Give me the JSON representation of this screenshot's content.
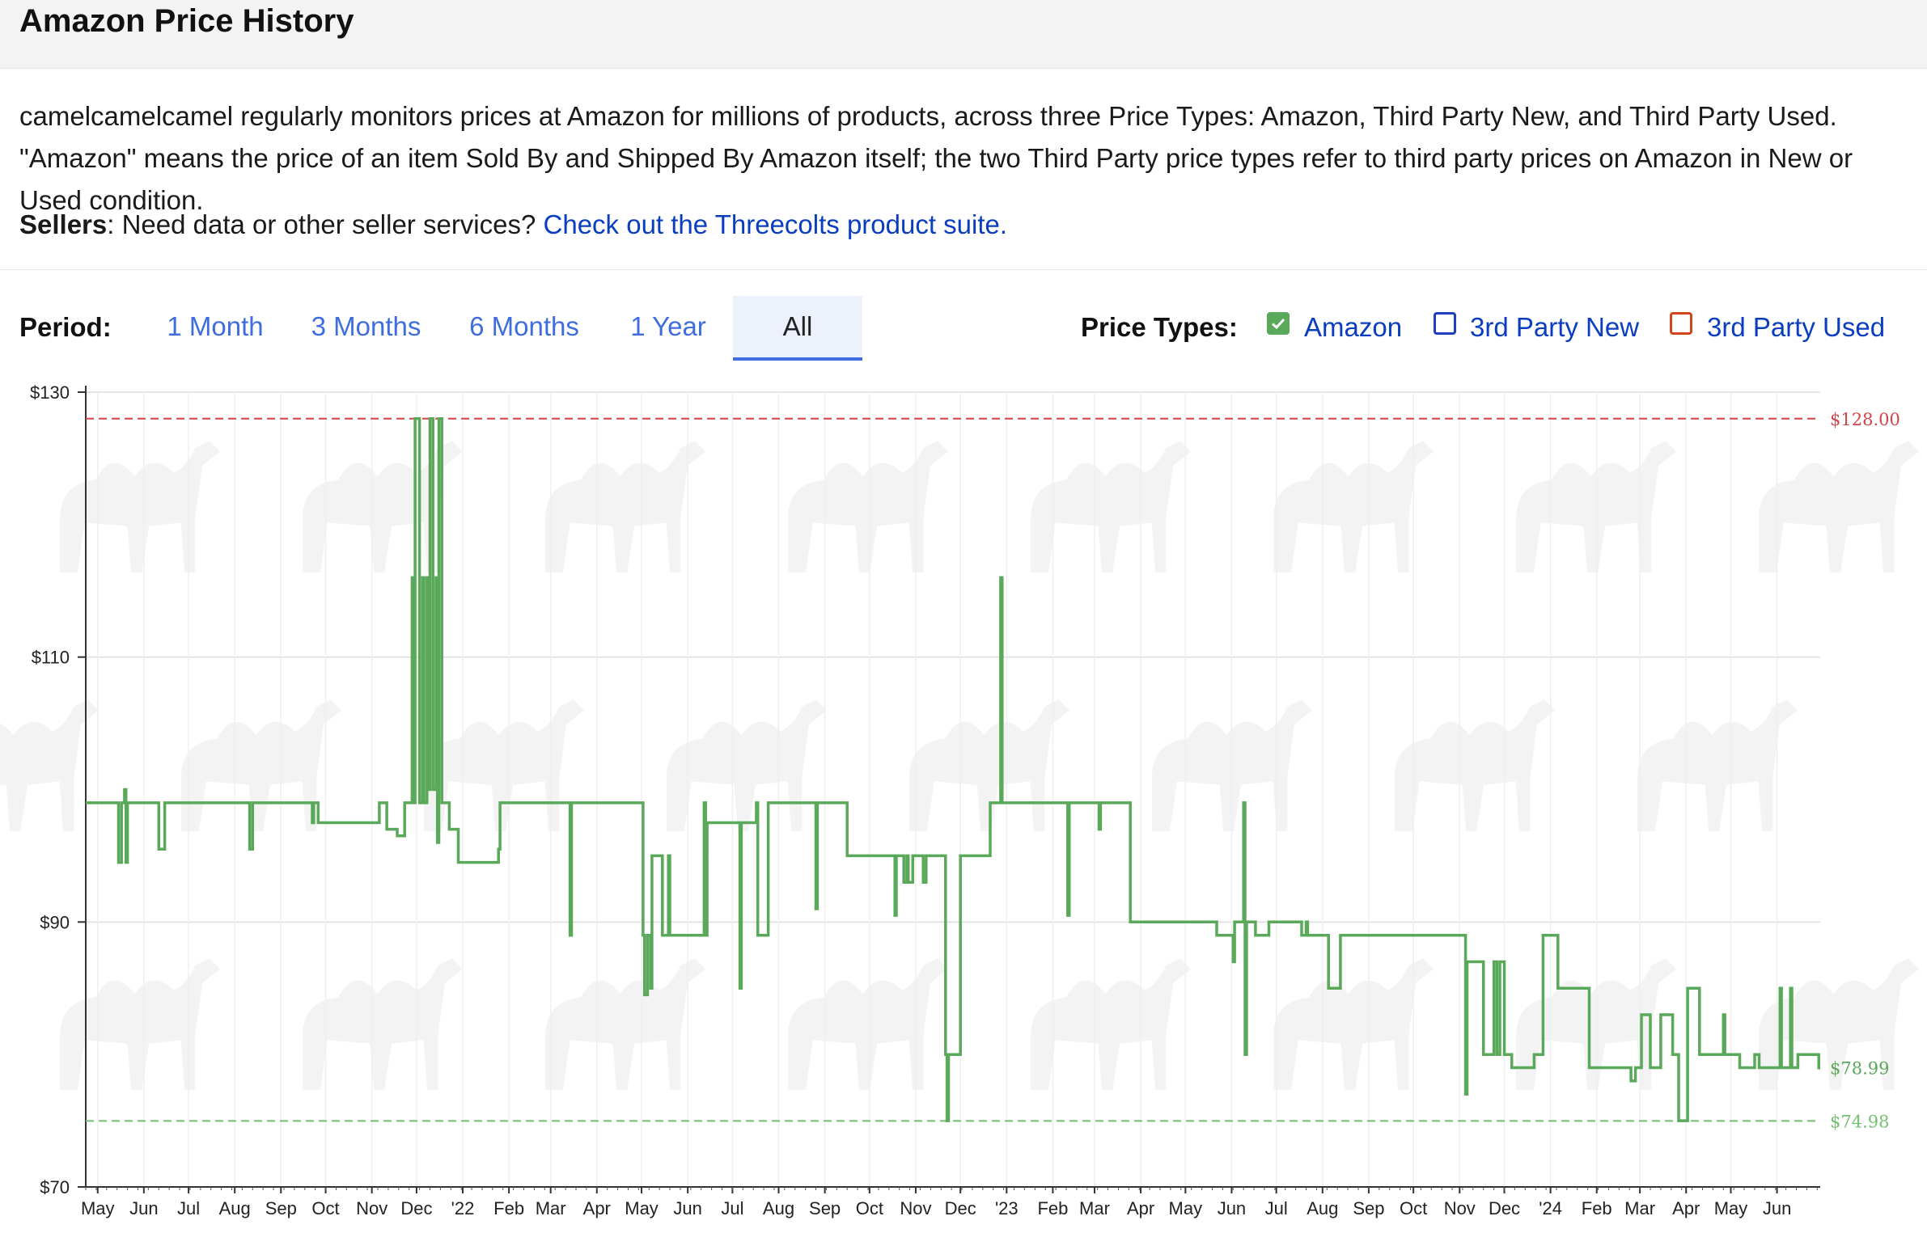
{
  "header": {
    "title": "Amazon Price History"
  },
  "description": "camelcamelcamel regularly monitors prices at Amazon for millions of products, across three Price Types: Amazon, Third Party New, and Third Party Used. \"Amazon\" means the price of an item Sold By and Shipped By Amazon itself; the two Third Party price types refer to third party prices on Amazon in New or Used condition.",
  "sellers": {
    "label": "Sellers",
    "text": ": Need data or other seller services? ",
    "link": "Check out the Threecolts product suite."
  },
  "period": {
    "label": "Period:",
    "tabs": [
      "1 Month",
      "3 Months",
      "6 Months",
      "1 Year",
      "All"
    ],
    "selected": "All"
  },
  "price_types": {
    "label": "Price Types:",
    "items": [
      {
        "label": "Amazon",
        "checked": true,
        "color": "#5aa85a"
      },
      {
        "label": "3rd Party New",
        "checked": false,
        "color": "#1f3fbf"
      },
      {
        "label": "3rd Party Used",
        "checked": false,
        "color": "#d0451b"
      }
    ]
  },
  "chart_data": {
    "type": "line",
    "x_type": "date",
    "ylim": [
      70,
      130
    ],
    "yticks": [
      "$130",
      "$110",
      "$90",
      "$70"
    ],
    "xlim": [
      "2021-04-23",
      "2024-06-30"
    ],
    "month_ticks": [
      "May",
      "Jun",
      "Jul",
      "Aug",
      "Sep",
      "Oct",
      "Nov",
      "Dec",
      "'22",
      "Feb",
      "Mar",
      "Apr",
      "May",
      "Jun",
      "Jul",
      "Aug",
      "Sep",
      "Oct",
      "Nov",
      "Dec",
      "'23",
      "Feb",
      "Mar",
      "Apr",
      "May",
      "Jun",
      "Jul",
      "Aug",
      "Sep",
      "Oct",
      "Nov",
      "Dec",
      "'24",
      "Feb",
      "Mar",
      "Apr",
      "May",
      "Jun"
    ],
    "reference_lines": [
      {
        "label": "$128.00",
        "value": 128.0,
        "color": "#d0454b",
        "style": "dashed"
      },
      {
        "label": "$74.98",
        "value": 74.98,
        "color": "#72c072",
        "style": "dashed"
      }
    ],
    "current_price_label": {
      "label": "$78.99",
      "value": 78.99,
      "color": "#5aa85a"
    },
    "series": [
      {
        "name": "Amazon",
        "color": "#5aa85a",
        "points": [
          [
            "2021-04-23",
            99
          ],
          [
            "2021-05-14",
            99
          ],
          [
            "2021-05-15",
            94.5
          ],
          [
            "2021-05-17",
            99
          ],
          [
            "2021-05-19",
            100
          ],
          [
            "2021-05-20",
            94.5
          ],
          [
            "2021-05-21",
            99
          ],
          [
            "2021-06-10",
            99
          ],
          [
            "2021-06-11",
            95.5
          ],
          [
            "2021-06-15",
            99
          ],
          [
            "2021-07-15",
            99
          ],
          [
            "2021-08-10",
            99
          ],
          [
            "2021-08-11",
            95.5
          ],
          [
            "2021-08-13",
            99
          ],
          [
            "2021-09-21",
            99
          ],
          [
            "2021-09-22",
            97.5
          ],
          [
            "2021-09-23",
            99
          ],
          [
            "2021-09-26",
            97.5
          ],
          [
            "2021-10-05",
            97.5
          ],
          [
            "2021-11-05",
            97.5
          ],
          [
            "2021-11-06",
            99
          ],
          [
            "2021-11-10",
            99
          ],
          [
            "2021-11-11",
            97
          ],
          [
            "2021-11-17",
            97
          ],
          [
            "2021-11-18",
            96.5
          ],
          [
            "2021-11-22",
            96.5
          ],
          [
            "2021-11-23",
            99
          ],
          [
            "2021-11-27",
            99
          ],
          [
            "2021-11-28",
            116
          ],
          [
            "2021-11-29",
            99
          ],
          [
            "2021-11-30",
            128
          ],
          [
            "2021-12-03",
            99
          ],
          [
            "2021-12-05",
            116
          ],
          [
            "2021-12-06",
            99
          ],
          [
            "2021-12-08",
            116
          ],
          [
            "2021-12-09",
            100
          ],
          [
            "2021-12-10",
            128
          ],
          [
            "2021-12-12",
            100
          ],
          [
            "2021-12-14",
            116
          ],
          [
            "2021-12-15",
            96
          ],
          [
            "2021-12-16",
            128
          ],
          [
            "2021-12-18",
            99
          ],
          [
            "2021-12-22",
            99
          ],
          [
            "2021-12-23",
            97
          ],
          [
            "2021-12-28",
            97
          ],
          [
            "2021-12-29",
            94.5
          ],
          [
            "2022-01-24",
            94.5
          ],
          [
            "2022-01-25",
            95.5
          ],
          [
            "2022-01-26",
            99
          ],
          [
            "2022-03-13",
            99
          ],
          [
            "2022-03-14",
            89
          ],
          [
            "2022-03-15",
            99
          ],
          [
            "2022-05-01",
            99
          ],
          [
            "2022-05-02",
            89
          ],
          [
            "2022-05-03",
            84.5
          ],
          [
            "2022-05-05",
            89
          ],
          [
            "2022-05-07",
            85
          ],
          [
            "2022-05-08",
            95
          ],
          [
            "2022-05-14",
            95
          ],
          [
            "2022-05-15",
            89
          ],
          [
            "2022-05-18",
            89
          ],
          [
            "2022-05-19",
            95
          ],
          [
            "2022-05-20",
            89
          ],
          [
            "2022-06-11",
            89
          ],
          [
            "2022-06-12",
            99
          ],
          [
            "2022-06-13",
            89
          ],
          [
            "2022-06-14",
            97.5
          ],
          [
            "2022-07-01",
            97.5
          ],
          [
            "2022-07-05",
            97.5
          ],
          [
            "2022-07-06",
            85
          ],
          [
            "2022-07-07",
            97.5
          ],
          [
            "2022-07-16",
            97.5
          ],
          [
            "2022-07-17",
            99
          ],
          [
            "2022-07-18",
            89
          ],
          [
            "2022-07-24",
            89
          ],
          [
            "2022-07-25",
            99
          ],
          [
            "2022-08-25",
            99
          ],
          [
            "2022-08-26",
            91
          ],
          [
            "2022-08-27",
            99
          ],
          [
            "2022-09-15",
            99
          ],
          [
            "2022-09-16",
            95
          ],
          [
            "2022-10-17",
            95
          ],
          [
            "2022-10-18",
            90.5
          ],
          [
            "2022-10-19",
            95
          ],
          [
            "2022-10-23",
            95
          ],
          [
            "2022-10-24",
            93
          ],
          [
            "2022-10-26",
            95
          ],
          [
            "2022-10-27",
            93
          ],
          [
            "2022-10-30",
            95
          ],
          [
            "2022-11-05",
            95
          ],
          [
            "2022-11-06",
            93
          ],
          [
            "2022-11-08",
            95
          ],
          [
            "2022-11-20",
            95
          ],
          [
            "2022-11-21",
            80
          ],
          [
            "2022-11-22",
            75
          ],
          [
            "2022-11-23",
            80
          ],
          [
            "2022-11-30",
            80
          ],
          [
            "2022-12-01",
            95
          ],
          [
            "2022-12-20",
            95
          ],
          [
            "2022-12-21",
            99
          ],
          [
            "2022-12-27",
            99
          ],
          [
            "2022-12-28",
            116
          ],
          [
            "2022-12-29",
            99
          ],
          [
            "2023-02-10",
            99
          ],
          [
            "2023-02-11",
            90.5
          ],
          [
            "2023-02-12",
            99
          ],
          [
            "2023-03-03",
            99
          ],
          [
            "2023-03-04",
            97
          ],
          [
            "2023-03-05",
            99
          ],
          [
            "2023-03-24",
            99
          ],
          [
            "2023-03-25",
            90
          ],
          [
            "2023-05-21",
            90
          ],
          [
            "2023-05-22",
            89
          ],
          [
            "2023-06-01",
            89
          ],
          [
            "2023-06-02",
            87
          ],
          [
            "2023-06-03",
            90
          ],
          [
            "2023-06-08",
            90
          ],
          [
            "2023-06-09",
            99
          ],
          [
            "2023-06-10",
            80
          ],
          [
            "2023-06-11",
            90
          ],
          [
            "2023-06-16",
            90
          ],
          [
            "2023-06-17",
            89
          ],
          [
            "2023-06-25",
            89
          ],
          [
            "2023-06-26",
            90
          ],
          [
            "2023-07-17",
            90
          ],
          [
            "2023-07-18",
            89
          ],
          [
            "2023-07-21",
            90
          ],
          [
            "2023-07-22",
            89
          ],
          [
            "2023-08-04",
            89
          ],
          [
            "2023-08-05",
            85
          ],
          [
            "2023-08-12",
            85
          ],
          [
            "2023-08-13",
            89
          ],
          [
            "2023-11-04",
            89
          ],
          [
            "2023-11-05",
            77
          ],
          [
            "2023-11-06",
            87
          ],
          [
            "2023-11-16",
            87
          ],
          [
            "2023-11-17",
            80
          ],
          [
            "2023-11-23",
            80
          ],
          [
            "2023-11-24",
            87
          ],
          [
            "2023-11-26",
            80
          ],
          [
            "2023-11-28",
            87
          ],
          [
            "2023-12-01",
            80
          ],
          [
            "2023-12-05",
            80
          ],
          [
            "2023-12-06",
            79
          ],
          [
            "2023-12-20",
            79
          ],
          [
            "2023-12-21",
            80
          ],
          [
            "2023-12-26",
            80
          ],
          [
            "2023-12-27",
            89
          ],
          [
            "2024-01-05",
            89
          ],
          [
            "2024-01-06",
            85
          ],
          [
            "2024-01-26",
            85
          ],
          [
            "2024-01-27",
            79
          ],
          [
            "2024-02-23",
            79
          ],
          [
            "2024-02-24",
            78
          ],
          [
            "2024-02-27",
            79
          ],
          [
            "2024-03-01",
            79
          ],
          [
            "2024-03-02",
            83
          ],
          [
            "2024-03-07",
            83
          ],
          [
            "2024-03-08",
            79
          ],
          [
            "2024-03-14",
            79
          ],
          [
            "2024-03-15",
            83
          ],
          [
            "2024-03-22",
            83
          ],
          [
            "2024-03-23",
            80
          ],
          [
            "2024-03-27",
            75
          ],
          [
            "2024-04-01",
            75
          ],
          [
            "2024-04-02",
            85
          ],
          [
            "2024-04-09",
            85
          ],
          [
            "2024-04-10",
            80
          ],
          [
            "2024-04-25",
            80
          ],
          [
            "2024-04-26",
            83
          ],
          [
            "2024-04-27",
            80
          ],
          [
            "2024-05-06",
            80
          ],
          [
            "2024-05-07",
            79
          ],
          [
            "2024-05-16",
            79
          ],
          [
            "2024-05-17",
            80
          ],
          [
            "2024-05-20",
            79
          ],
          [
            "2024-06-02",
            79
          ],
          [
            "2024-06-03",
            85
          ],
          [
            "2024-06-04",
            79
          ],
          [
            "2024-06-09",
            79
          ],
          [
            "2024-06-10",
            85
          ],
          [
            "2024-06-11",
            79
          ],
          [
            "2024-06-14",
            79
          ],
          [
            "2024-06-15",
            80
          ],
          [
            "2024-06-28",
            80
          ],
          [
            "2024-06-29",
            78.99
          ],
          [
            "2024-06-30",
            78.99
          ]
        ]
      }
    ]
  }
}
